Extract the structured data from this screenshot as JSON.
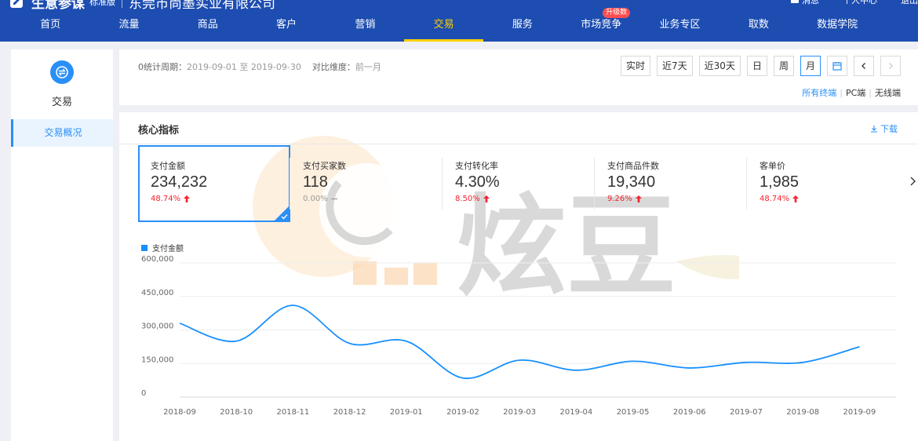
{
  "header": {
    "app_name": "生意参谋",
    "edition": "标准版",
    "company": "东莞市尚墨实业有限公司",
    "user_links": [
      "消息",
      "个人中心",
      "退出"
    ]
  },
  "nav": {
    "items": [
      {
        "label": "首页"
      },
      {
        "label": "流量"
      },
      {
        "label": "商品"
      },
      {
        "label": "客户"
      },
      {
        "label": "营销"
      },
      {
        "label": "交易",
        "active": true
      },
      {
        "label": "服务"
      },
      {
        "label": "市场竞争",
        "badge": "升级数"
      },
      {
        "label": "业务专区"
      },
      {
        "label": "取数"
      },
      {
        "label": "数据学院"
      }
    ]
  },
  "sidebar": {
    "title": "交易",
    "items": [
      {
        "label": "交易概况",
        "active": true
      }
    ]
  },
  "filter": {
    "period_label": "0统计周期：",
    "period_value": "2019-09-01 至 2019-09-30",
    "compare_label": "对比维度：",
    "compare_value": "前一月",
    "buttons": {
      "realtime": "实时",
      "last7": "近7天",
      "last30": "近30天",
      "day": "日",
      "week": "周",
      "month": "月"
    },
    "terminals": [
      "所有终端",
      "PC端",
      "无线端"
    ]
  },
  "core": {
    "title": "核心指标",
    "download": "下载",
    "metrics": [
      {
        "label": "支付金额",
        "value": "234,232",
        "change": "48.74%",
        "trend": "up",
        "selected": true
      },
      {
        "label": "支付买家数",
        "value": "118",
        "change": "0.00%",
        "trend": "flat"
      },
      {
        "label": "支付转化率",
        "value": "4.30%",
        "change": "8.50%",
        "trend": "up"
      },
      {
        "label": "支付商品件数",
        "value": "19,340",
        "change": "9.26%",
        "trend": "up"
      },
      {
        "label": "客单价",
        "value": "1,985",
        "change": "48.74%",
        "trend": "up"
      }
    ]
  },
  "watermark": {
    "text": "炫豆"
  },
  "chart_data": {
    "type": "line",
    "legend": "支付金额",
    "categories": [
      "2018-09",
      "2018-10",
      "2018-11",
      "2018-12",
      "2019-01",
      "2019-02",
      "2019-03",
      "2019-04",
      "2019-05",
      "2019-06",
      "2019-07",
      "2019-08",
      "2019-09"
    ],
    "y_ticks": [
      "0",
      "150,000",
      "300,000",
      "450,000",
      "600,000"
    ],
    "ylim": [
      0,
      600000
    ],
    "series": [
      {
        "name": "支付金额",
        "color": "#1890ff",
        "values": [
          330000,
          250000,
          410000,
          240000,
          250000,
          85000,
          165000,
          120000,
          160000,
          130000,
          155000,
          155000,
          225000
        ]
      }
    ],
    "grid": true
  },
  "colors": {
    "nav_bg": "#1d4db1",
    "active_nav": "#ffd100",
    "accent": "#2a8ff7",
    "up": "#f5222d"
  }
}
